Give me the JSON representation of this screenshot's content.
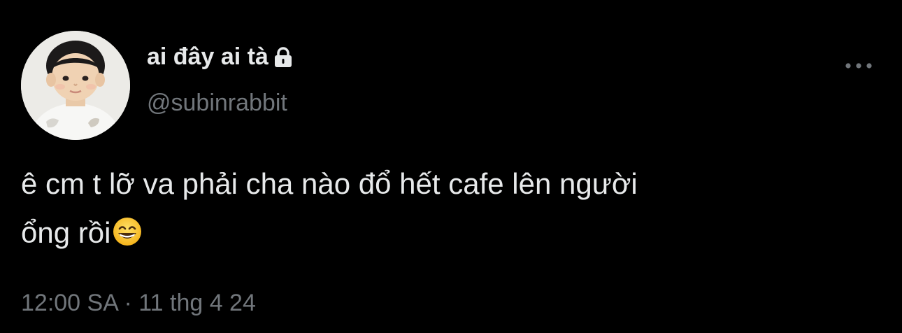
{
  "tweet": {
    "display_name": "ai đây ai tà",
    "handle": "@subinrabbit",
    "text_line1": "ê cm t lỡ va phải cha nào đổ hết cafe lên người",
    "text_line2": "ổng rồi",
    "emoji": "grinning-face-with-smiling-eyes",
    "time": "12:00 SA",
    "separator": "·",
    "date": "11 thg 4 24",
    "protected_icon": "lock-icon",
    "more_icon": "ellipsis-icon"
  },
  "colors": {
    "background": "#000000",
    "primary_text": "#e7e9ea",
    "secondary_text": "#71767b"
  }
}
